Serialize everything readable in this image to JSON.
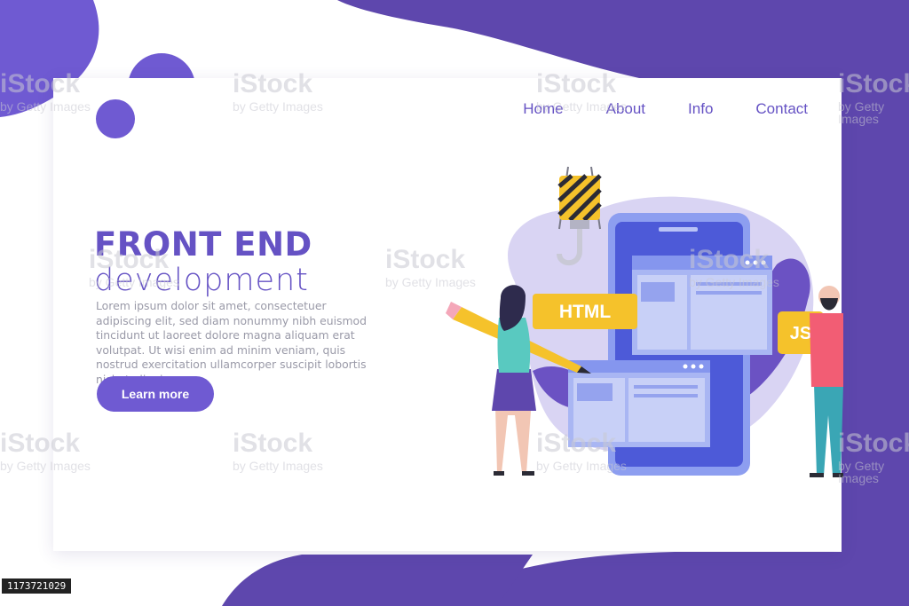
{
  "nav": {
    "items": [
      "Home",
      "About",
      "Info",
      "Contact"
    ]
  },
  "hero": {
    "title": "FRONT END",
    "subtitle": "development",
    "body": "Lorem ipsum dolor sit amet, consectetuer adipiscing elit, sed diam nonummy nibh euismod tincidunt ut laoreet dolore magna aliquam erat volutpat. Ut wisi enim ad minim veniam, quis nostrud exercitation ullamcorper suscipit lobortis nisl ut aliquip ex",
    "button_label": "Learn more"
  },
  "illustration": {
    "html_label": "HTML",
    "js_label": "JS"
  },
  "watermark": {
    "brand": "iStock",
    "credit": "by Getty Images"
  },
  "image_id": "1173721029",
  "colors": {
    "brand": "#6552c4",
    "accent": "#6f5ad2",
    "dark": "#5f46b0",
    "tag": "#f5c22b"
  }
}
